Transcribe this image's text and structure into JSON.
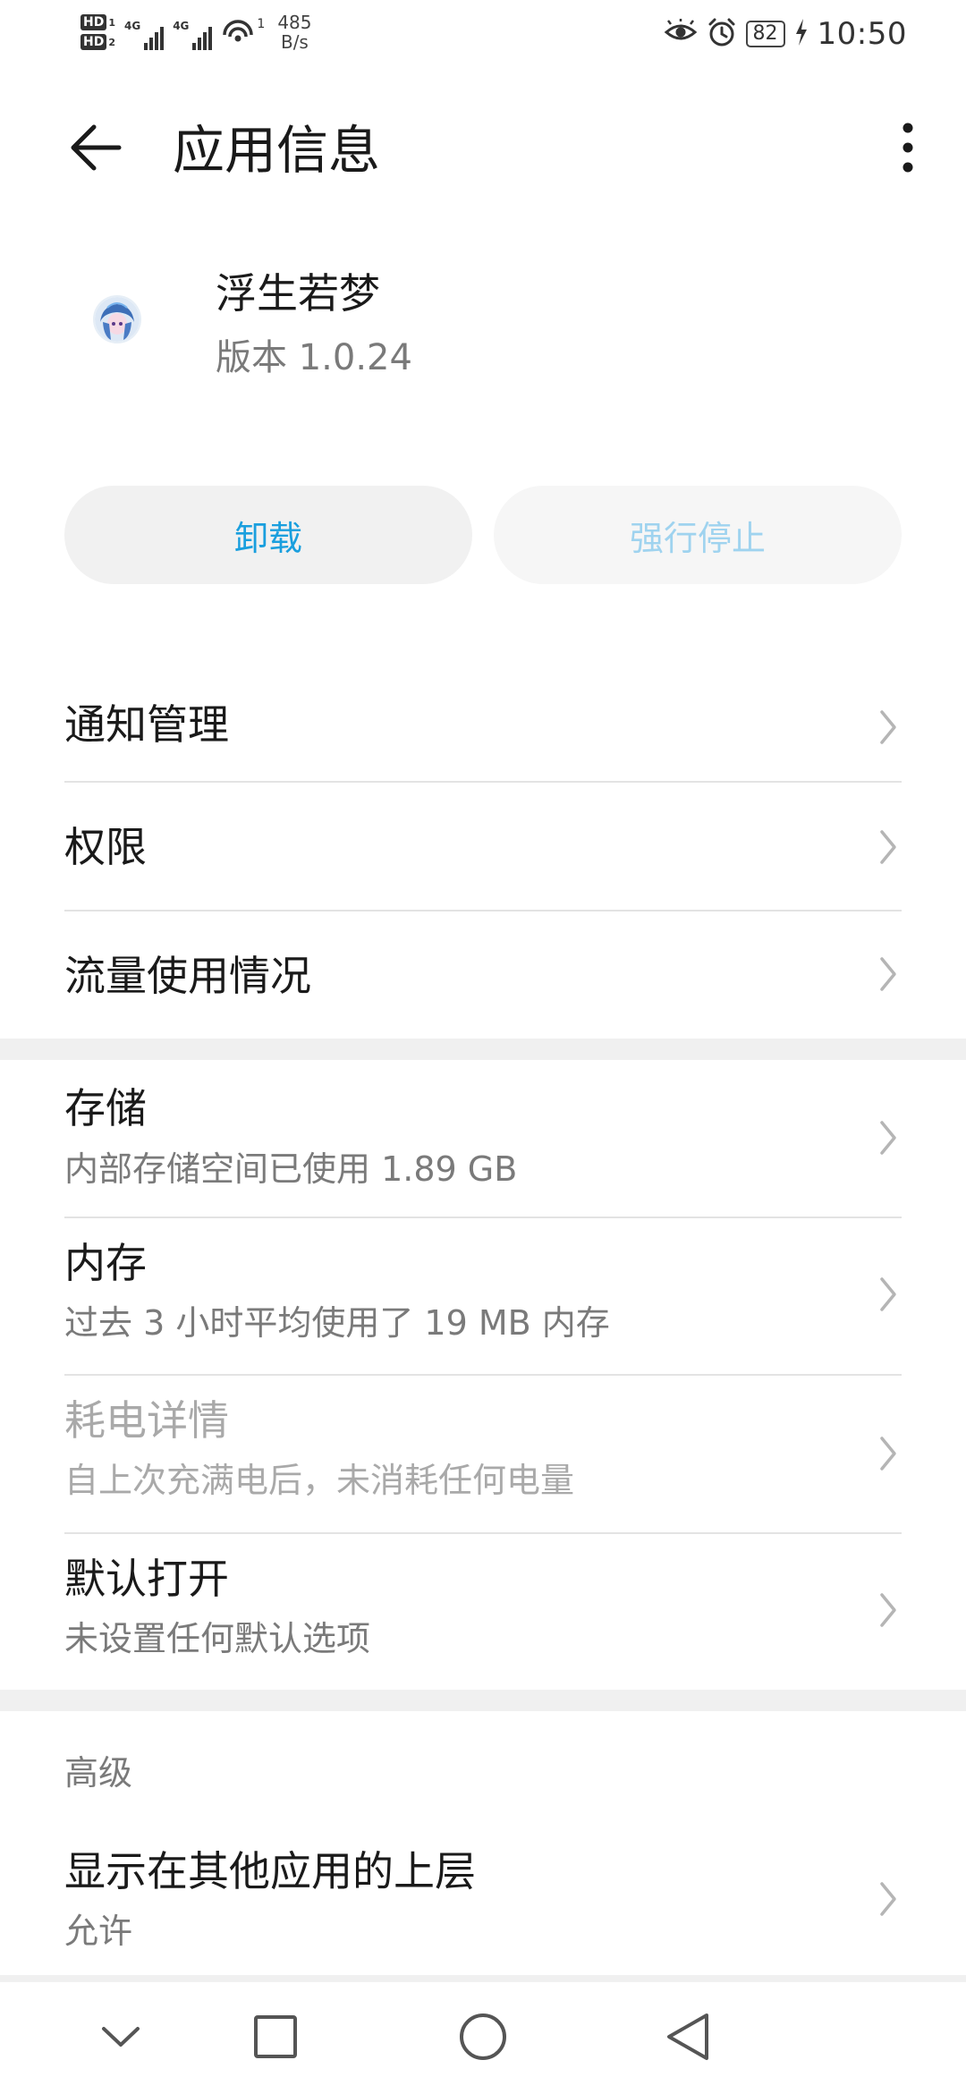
{
  "status_bar": {
    "hd1": "HD",
    "hd1_sub": "1",
    "hd2": "HD",
    "hd2_sub": "2",
    "net1": "4G",
    "net2": "4G",
    "wifi_sup": "1",
    "speed_value": "485",
    "speed_unit": "B/s",
    "battery": "82",
    "time": "10:50"
  },
  "app_bar": {
    "title": "应用信息"
  },
  "app": {
    "name": "浮生若梦",
    "version": "版本 1.0.24"
  },
  "actions": {
    "uninstall": "卸载",
    "force_stop": "强行停止"
  },
  "menu": {
    "notifications": "通知管理",
    "permissions": "权限",
    "data_usage": "流量使用情况"
  },
  "details": {
    "storage": {
      "title": "存储",
      "subtitle": "内部存储空间已使用 1.89 GB"
    },
    "memory": {
      "title": "内存",
      "subtitle": "过去 3 小时平均使用了 19 MB 内存"
    },
    "battery": {
      "title": "耗电详情",
      "subtitle": "自上次充满电后，未消耗任何电量"
    },
    "default_open": {
      "title": "默认打开",
      "subtitle": "未设置任何默认选项"
    }
  },
  "advanced": {
    "header": "高级",
    "overlay": {
      "title": "显示在其他应用的上层",
      "subtitle": "允许"
    }
  },
  "colors": {
    "accent": "#1a9fde",
    "accent_disabled": "#9fd3ef"
  }
}
